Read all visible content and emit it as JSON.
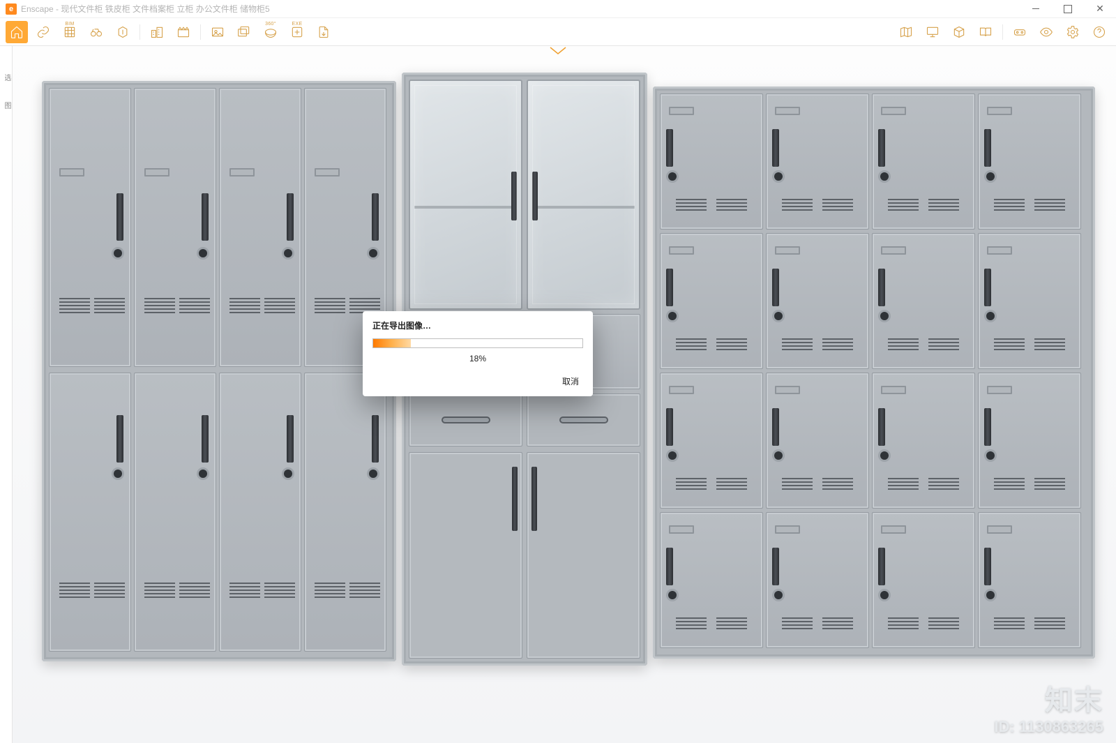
{
  "window": {
    "app_name": "Enscape",
    "title_suffix": "现代文件柜 铁皮柜 文件档案柜 立柜 办公文件柜 储物柜5",
    "logo_letter": "e"
  },
  "window_controls": {
    "minimize_tooltip": "Minimize",
    "maximize_tooltip": "Maximize",
    "close_tooltip": "Close"
  },
  "toolbar": {
    "left": [
      {
        "name": "home",
        "label": ""
      },
      {
        "name": "link",
        "label": ""
      },
      {
        "name": "bim",
        "label": "BIM"
      },
      {
        "name": "binoculars",
        "label": ""
      },
      {
        "name": "favorite",
        "label": ""
      },
      {
        "name": "sep",
        "label": ""
      },
      {
        "name": "buildings",
        "label": ""
      },
      {
        "name": "clapper",
        "label": ""
      },
      {
        "name": "sep",
        "label": ""
      },
      {
        "name": "export-image",
        "label": ""
      },
      {
        "name": "export-batch",
        "label": ""
      },
      {
        "name": "export-pano",
        "label": "360°"
      },
      {
        "name": "export-exe",
        "label": "EXE"
      },
      {
        "name": "export-file",
        "label": ""
      }
    ],
    "right": [
      {
        "name": "map",
        "label": ""
      },
      {
        "name": "monitor",
        "label": ""
      },
      {
        "name": "box",
        "label": ""
      },
      {
        "name": "book-open",
        "label": ""
      },
      {
        "name": "sep",
        "label": ""
      },
      {
        "name": "vr-headset",
        "label": ""
      },
      {
        "name": "eye",
        "label": ""
      },
      {
        "name": "settings",
        "label": ""
      },
      {
        "name": "help",
        "label": ""
      }
    ]
  },
  "dialog": {
    "title": "正在导出图像…",
    "progress_percent": 18,
    "progress_label": "18%",
    "cancel_label": "取消"
  },
  "left_sidebar": {
    "tab1": "选",
    "tab2": "图"
  },
  "watermark": {
    "brand": "知末",
    "id_label": "ID: 1130863265"
  },
  "colors": {
    "accent": "#ffa936",
    "progress_start": "#ff7a00",
    "progress_end": "#ffd9a3",
    "cabinet_metal": "#b3b8bd"
  }
}
